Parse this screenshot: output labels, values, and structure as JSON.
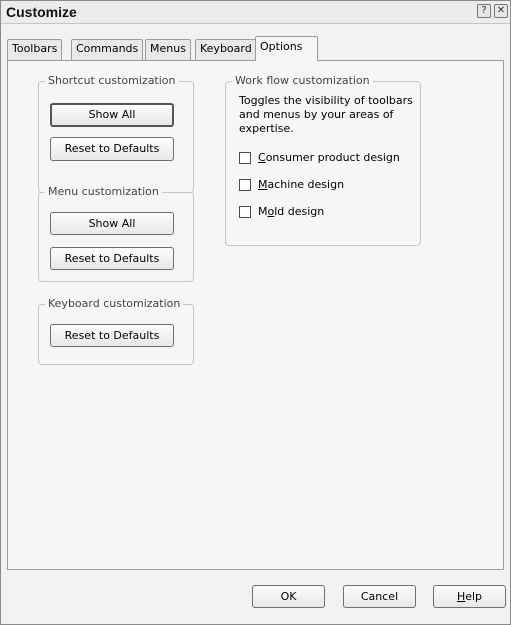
{
  "window": {
    "title": "Customize",
    "help_glyph": "?",
    "close_glyph": "✕"
  },
  "tabs": [
    {
      "label": "Toolbars"
    },
    {
      "label": "Commands"
    },
    {
      "label": "Menus"
    },
    {
      "label": "Keyboard"
    },
    {
      "label": "Options",
      "active": true
    }
  ],
  "shortcut": {
    "legend": "Shortcut customization",
    "show_all": "Show All",
    "reset": "Reset to Defaults"
  },
  "menu": {
    "legend": "Menu customization",
    "show_all": "Show All",
    "reset": "Reset to Defaults"
  },
  "keyboard": {
    "legend": "Keyboard customization",
    "reset": "Reset to Defaults"
  },
  "workflow": {
    "legend": "Work flow customization",
    "description": "Toggles the visibility of toolbars and menus by your areas of expertise.",
    "options": [
      {
        "accel": "C",
        "rest": "onsumer product design",
        "checked": false
      },
      {
        "accel": "M",
        "rest": "achine design",
        "checked": false
      },
      {
        "pre": "M",
        "accel": "o",
        "rest": "ld design",
        "checked": false
      }
    ]
  },
  "footer": {
    "ok": "OK",
    "cancel": "Cancel",
    "help_accel": "H",
    "help_rest": "elp"
  }
}
